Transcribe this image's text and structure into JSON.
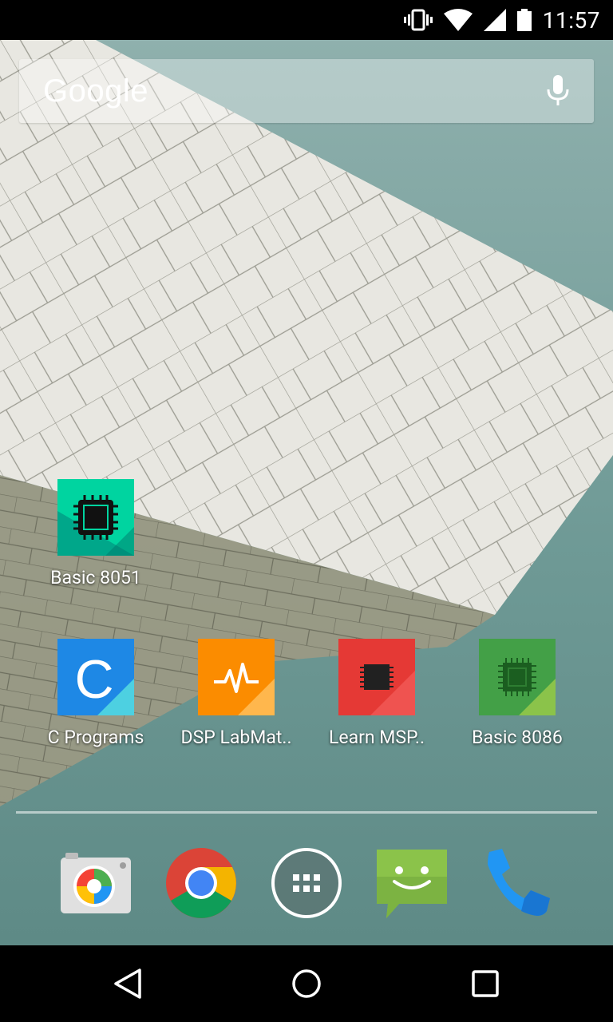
{
  "status_bar": {
    "time": "11:57",
    "icons": [
      "vibrate-icon",
      "wifi-icon",
      "signal-icon",
      "battery-icon"
    ]
  },
  "search": {
    "logo_text": "Google",
    "voice_icon": "mic-icon"
  },
  "apps": [
    {
      "label": "Basic 8051",
      "icon": "chip-icon",
      "color": "#00b894"
    },
    {
      "label": "C Programs",
      "icon": "letter-c-icon",
      "color": "#1e88e5"
    },
    {
      "label": "DSP LabMat..",
      "icon": "pulse-icon",
      "color": "#fb8c00"
    },
    {
      "label": "Learn MSP..",
      "icon": "chip-icon",
      "color": "#e53935"
    },
    {
      "label": "Basic 8086",
      "icon": "chip-icon",
      "color": "#43a047"
    }
  ],
  "dock": [
    {
      "name": "camera",
      "icon": "camera-icon"
    },
    {
      "name": "chrome",
      "icon": "chrome-icon"
    },
    {
      "name": "app-drawer",
      "icon": "app-drawer-icon"
    },
    {
      "name": "messaging",
      "icon": "messaging-icon"
    },
    {
      "name": "phone",
      "icon": "phone-icon"
    }
  ],
  "nav": [
    "back-icon",
    "home-icon",
    "recents-icon"
  ]
}
